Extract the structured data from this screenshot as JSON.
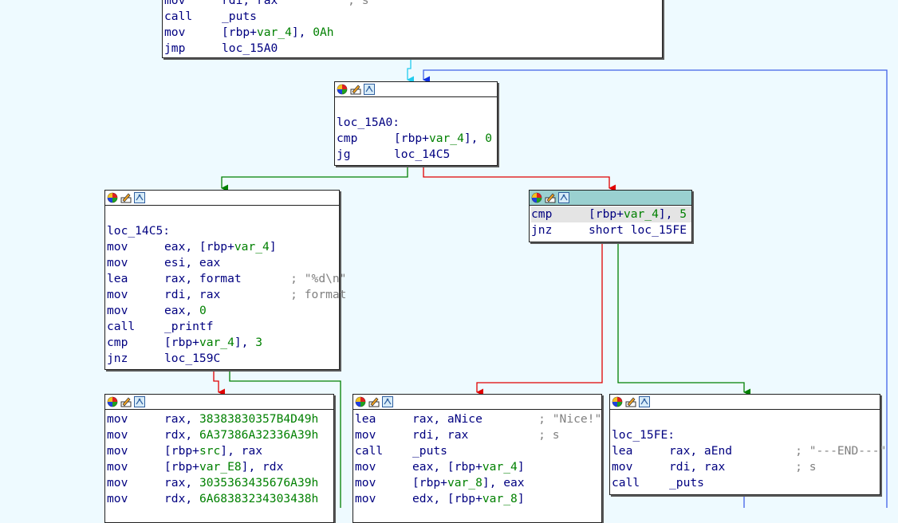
{
  "colors": {
    "background": "#eefaff",
    "text": "#000080",
    "variable": "#008000",
    "comment": "#808080",
    "edge_true": "#008000",
    "edge_false": "#e00000",
    "edge_loop": "#4060e8",
    "edge_cyan": "#22ccee",
    "selected_header": "#9ad0d0"
  },
  "icons": [
    "color-palette-icon",
    "rename-icon",
    "graph-mode-icon"
  ],
  "nodes": {
    "top": {
      "lines": [
        {
          "mn": "mov",
          "ops": "rdi, rax",
          "cmt": "; s"
        },
        {
          "mn": "call",
          "ops": "_puts"
        },
        {
          "mn": "mov",
          "a": "[rbp+",
          "v": "var_4",
          "b": "], ",
          "n": "0Ah"
        },
        {
          "mn": "jmp",
          "ops": "loc_15A0"
        }
      ]
    },
    "loc15a0": {
      "label": "loc_15A0:",
      "lines": [
        {
          "mn": "cmp",
          "a": "[rbp+",
          "v": "var_4",
          "b": "], ",
          "n": "0"
        },
        {
          "mn": "jg",
          "ops": "loc_14C5"
        }
      ]
    },
    "cmp5": {
      "lines": [
        {
          "mn": "cmp",
          "a": "[rbp+",
          "v": "var_4",
          "b": "], ",
          "n": "5"
        },
        {
          "mn": "jnz",
          "ops": "short loc_15FE"
        }
      ]
    },
    "loc14c5": {
      "label": "loc_14C5:",
      "lines": [
        {
          "mn": "mov",
          "a": "eax, [rbp+",
          "v": "var_4",
          "b": "]"
        },
        {
          "mn": "mov",
          "ops": "esi, eax"
        },
        {
          "mn": "lea",
          "ops": "rax, format",
          "cmt": "; \"%d\\n\""
        },
        {
          "mn": "mov",
          "ops": "rdi, rax",
          "cmt": "; format"
        },
        {
          "mn": "mov",
          "a": "eax, ",
          "n": "0"
        },
        {
          "mn": "call",
          "ops": "_printf"
        },
        {
          "mn": "cmp",
          "a": "[rbp+",
          "v": "var_4",
          "b": "], ",
          "n": "3"
        },
        {
          "mn": "jnz",
          "ops": "loc_159C"
        }
      ]
    },
    "strs": {
      "lines": [
        {
          "mn": "mov",
          "a": "rax, ",
          "n": "38383830357B4D49h"
        },
        {
          "mn": "mov",
          "a": "rdx, ",
          "n": "6A37386A32336A39h"
        },
        {
          "mn": "mov",
          "a": "[rbp+",
          "v": "src",
          "b": "], rax"
        },
        {
          "mn": "mov",
          "a": "[rbp+",
          "v": "var_E8",
          "b": "], rdx"
        },
        {
          "mn": "mov",
          "a": "rax, ",
          "n": "3035363435676A39h"
        },
        {
          "mn": "mov",
          "a": "rdx, ",
          "n": "6A68383234303438h"
        }
      ]
    },
    "nice": {
      "lines": [
        {
          "mn": "lea",
          "ops": "rax, aNice",
          "cmt": "; \"Nice!\""
        },
        {
          "mn": "mov",
          "ops": "rdi, rax",
          "cmt": "; s"
        },
        {
          "mn": "call",
          "ops": "_puts"
        },
        {
          "mn": "mov",
          "a": "eax, [rbp+",
          "v": "var_4",
          "b": "]"
        },
        {
          "mn": "mov",
          "a": "[rbp+",
          "v": "var_8",
          "b": "], eax"
        },
        {
          "mn": "mov",
          "a": "edx, [rbp+",
          "v": "var_8",
          "b": "]"
        }
      ]
    },
    "loc15fe": {
      "label": "loc_15FE:",
      "lines": [
        {
          "mn": "lea",
          "ops": "rax, aEnd",
          "cmt": "; \"---END---\""
        },
        {
          "mn": "mov",
          "ops": "rdi, rax",
          "cmt": "; s"
        },
        {
          "mn": "call",
          "ops": "_puts"
        }
      ]
    }
  }
}
